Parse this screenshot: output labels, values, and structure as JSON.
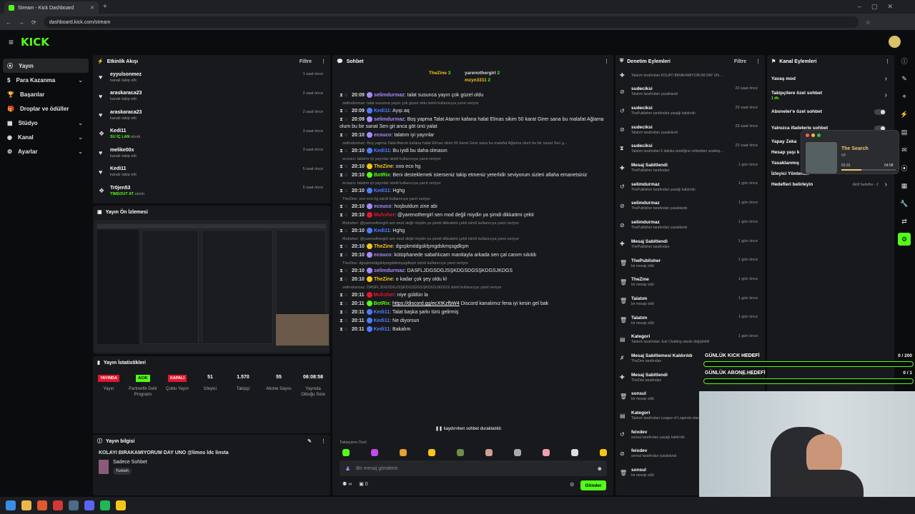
{
  "browser": {
    "tab_title": "Stream - Kick Dashboard",
    "url": "dashboard.kick.com/stream"
  },
  "brand": {
    "logo": "KICK",
    "accent": "#53fc18"
  },
  "sidebar": {
    "items": [
      {
        "label": "Yayın",
        "icon": "broadcast-icon",
        "active": true
      },
      {
        "label": "Para Kazanma",
        "icon": "money-icon",
        "chevron": true
      },
      {
        "label": "Başarılar",
        "icon": "trophy-icon"
      },
      {
        "label": "Droplar ve ödüller",
        "icon": "gift-icon"
      },
      {
        "label": "Stüdyo",
        "icon": "studio-icon",
        "chevron": true
      },
      {
        "label": "Kanal",
        "icon": "channel-icon",
        "chevron": true
      },
      {
        "label": "Ayarlar",
        "icon": "gear-icon",
        "chevron": true
      }
    ]
  },
  "activity": {
    "title": "Etkinlik Akışı",
    "filter": "Filtre",
    "events": [
      {
        "user": "eyyulsonmez",
        "action": "kanalı takip etti",
        "time": "1 saat önce",
        "icon": "heart-icon"
      },
      {
        "user": "araskaraca23",
        "action": "kanalı takip etti",
        "time": "2 saat önce",
        "icon": "heart-icon"
      },
      {
        "user": "araskaraca23",
        "action": "kanalı takip etti",
        "time": "2 saat önce",
        "icon": "heart-icon"
      },
      {
        "user": "Kedi11",
        "action": "SU İÇ LAN",
        "action2": "alındı",
        "time": "3 saat önce",
        "icon": "reward-icon"
      },
      {
        "user": "melike00x",
        "action": "kanalı takip etti",
        "time": "3 saat önce",
        "icon": "heart-icon"
      },
      {
        "user": "Kedi11",
        "action": "kanalı takip etti",
        "time": "5 saat önce",
        "icon": "heart-icon"
      },
      {
        "user": "Tr0jen53",
        "action": "TIMEOUT AT",
        "action2": "alındı",
        "time": "5 saat önce",
        "icon": "reward-icon"
      }
    ]
  },
  "preview": {
    "title": "Yayın Ön İzlemesi"
  },
  "stats": {
    "title": "Yayın İstatistikleri",
    "items": [
      {
        "tag": "YAYINDA",
        "label": "Yayın"
      },
      {
        "tag": "ACIK",
        "label": "Partnerlik Gelir Programı"
      },
      {
        "tag": "KAPALI",
        "label": "Çoklu Yayın"
      },
      {
        "value": "51",
        "label": "İzleyici"
      },
      {
        "value": "1.570",
        "label": "Takipçi"
      },
      {
        "value": "55",
        "label": "Abone Sayısı"
      },
      {
        "value": "06:08:58",
        "label": "Yayında Olduğu Süre"
      }
    ]
  },
  "info": {
    "title": "Yayın bilgisi",
    "stream_title": "KOLAYI BIRAKAMIYORUM DAY UNO @limos ldc linsta",
    "category": "Sadece Sohbet",
    "language": "Turkish"
  },
  "chat": {
    "title": "Sohbet",
    "pinned": [
      {
        "user": "TheZine",
        "value": "3"
      },
      {
        "user": "yarenothergirl",
        "value": "2"
      },
      {
        "user": "mzyn3311",
        "value": "2"
      }
    ],
    "messages": [
      {
        "time": "20:09",
        "user": "selimdurmaz",
        "color": "#a78bfa",
        "text": "talat susunca yayın çok güzel oldu"
      },
      {
        "reply": "selimdurmaz: talat susunca yayın çok güzel oldu isimli kullanıcıya yanıt veriyor"
      },
      {
        "time": "20:09",
        "user": "Kedi11",
        "color": "#4d7cff",
        "text": "Ayıp aq"
      },
      {
        "time": "20:09",
        "user": "selimdurmaz",
        "color": "#a78bfa",
        "text": "Boş yapma Talat Atarım kafana halat Elmas sikim 50 karat Girer sana bu malafat Ağlama olum bu bir sanat Sen git anca göt ünü yalat"
      },
      {
        "time": "20:10",
        "user": "ecouco",
        "color": "#a78bfa",
        "text": "talatım iyi yayınlar"
      },
      {
        "reply": "selimdurmaz: Boş yapma Talat Atarım kafana halat Elmas sikim 50 karat Girer sana bu malafat Ağlama olum bu bir sanat Sen g..."
      },
      {
        "time": "20:10",
        "user": "Kedi11",
        "color": "#4d7cff",
        "text": "Bu iyidi bu daha olmasın"
      },
      {
        "reply": "ecouco: talatım iyi yayınlar isimli kullanıcıya yanıt veriyor"
      },
      {
        "time": "20:10",
        "user": "TheZine",
        "color": "#f5c518",
        "text": "ooo eco hg"
      },
      {
        "time": "20:10",
        "user": "BotRix",
        "color": "#53fc18",
        "text": "Beni desteklemek isterseniz takip etmeniz yeterlidir seviyorum sizleri allaha emanetsiniz"
      },
      {
        "reply": "ecouco: talatım iyi yayınlar isimli kullanıcıya yanıt veriyor"
      },
      {
        "time": "20:10",
        "user": "Kedi11",
        "color": "#4d7cff",
        "text": "Hghg"
      },
      {
        "reply": "TheZine: ooo eco hg isimli kullanıcıya yanıt veriyor"
      },
      {
        "time": "20:10",
        "user": "ecouco",
        "color": "#a78bfa",
        "text": "hoşbuldum zine abi"
      },
      {
        "time": "20:10",
        "user": "Muhsher",
        "color": "#e0182d",
        "text": "@yarenothergirl sen mod değil miydin ya şimdi dikkatimi çekti"
      },
      {
        "reply": "Muhsher: @yarenothergirl sen mod değil miydin ya şimdi dikkatimi çekti isimli kullanıcıya yanıt veriyor"
      },
      {
        "time": "20:10",
        "user": "Kedi11",
        "color": "#4d7cff",
        "text": "Hghg"
      },
      {
        "reply": "Muhsher: @yarenothergirl sen mod değil miydin ya şimdi dikkatimi çekti isimli kullanıcıya yanıt veriyor"
      },
      {
        "time": "20:10",
        "user": "TheZine",
        "color": "#f5c518",
        "text": "dgsşkmödgsklşmgdskmşsgdkşm"
      },
      {
        "time": "20:10",
        "user": "ecouco",
        "color": "#a78bfa",
        "text": "kütüphanede sabahlıcam manitayla arkada sen çal canım sıkıldı"
      },
      {
        "reply": "TheZine: dgsşkmödgsklşmgdskmşsgdkşm isimli kullanıcıya yanıt veriyor"
      },
      {
        "time": "20:10",
        "user": "selimdurmaz",
        "color": "#a78bfa",
        "text": "DASFLJDGSDGJSŞKDGSDGSŞKDGSJKDGS"
      },
      {
        "time": "20:10",
        "user": "TheZine",
        "color": "#f5c518",
        "text": "o kadar çok şey oldu kl"
      },
      {
        "reply": "selimdurmaz: DASFLJDGSDGJSŞKDGSDGSŞKDGSJKDGS isimli kullanıcıya yanıt veriyor"
      },
      {
        "time": "20:11",
        "user": "Muhsher",
        "color": "#e0182d",
        "text": "niye güldün la"
      },
      {
        "time": "20:11",
        "user": "BotRix",
        "color": "#53fc18",
        "link": "https://discord.gg/ecXtKzfbW4",
        "text": "Discord kanalımız fena iyi kesin gel bak"
      },
      {
        "time": "20:11",
        "user": "Kedi11",
        "color": "#4d7cff",
        "text": "Talat başka şarkı türü gelirmiş"
      },
      {
        "time": "20:11",
        "user": "Kedi11",
        "color": "#4d7cff",
        "text": "Ne diyorsun"
      },
      {
        "time": "20:11",
        "user": "Kedi11",
        "color": "#4d7cff",
        "text": "Bakalım"
      }
    ],
    "paused": "kaydırırken sohbet duraklatıldı",
    "emote_label": "Takipçiere Özel",
    "input_placeholder": "Bir mesaj gönderin",
    "send": "Gönder",
    "count_users": "∞",
    "count_points": "0"
  },
  "mod": {
    "title": "Denetim Eylemleri",
    "filter": "Filtre",
    "entries": [
      {
        "user": "",
        "detail": "Talatım tarafından KOLAYI BIRAKAMIYORUM DAY UNO ldc linsta olarak değiştirildi",
        "time": "",
        "icon": "pin-icon"
      },
      {
        "user": "sudeciksi",
        "detail": "Talatım tarafından yasaklandı",
        "time": "23 saat önce",
        "icon": "ban-icon"
      },
      {
        "user": "sudeciksi",
        "detail": "ThePublisher tarafından yasağı kaldırıldı",
        "time": "23 saat önce",
        "icon": "unban-icon"
      },
      {
        "user": "sudeciksi",
        "detail": "Talatım tarafından yasaklandı",
        "time": "23 saat önce",
        "icon": "ban-icon"
      },
      {
        "user": "sudeciksi",
        "detail": "Talatım tarafından 5 dakika süreliğine sohbetten uzaklaştırıldı",
        "time": "23 saat önce",
        "icon": "timeout-icon"
      },
      {
        "user": "Mesaj Sabitlendi",
        "detail": "ThePublisher tarafından",
        "time": "1 gün önce",
        "icon": "pin-icon"
      },
      {
        "user": "selimdurmaz",
        "detail": "ThePublisher tarafından yasağı kaldırıldı",
        "time": "1 gün önce",
        "icon": "unban-icon"
      },
      {
        "user": "selimdurmaz",
        "detail": "ThePublisher tarafından yasaklandı",
        "time": "1 gün önce",
        "icon": "ban-icon"
      },
      {
        "user": "selimdurmaz",
        "detail": "ThePublisher tarafından yasaklandı",
        "time": "1 gün önce",
        "icon": "ban-icon"
      },
      {
        "user": "Mesaj Sabitlendi",
        "detail": "ThePublisher tarafından",
        "time": "1 gün önce",
        "icon": "pin-icon"
      },
      {
        "user": "ThePublisher",
        "detail": "bir mesajı sildi",
        "time": "1 gün önce",
        "icon": "trash-icon"
      },
      {
        "user": "TheZine",
        "detail": "bir mesajı sildi",
        "time": "1 gün önce",
        "icon": "trash-icon"
      },
      {
        "user": "Talatım",
        "detail": "bir mesajı sildi",
        "time": "1 gün önce",
        "icon": "trash-icon"
      },
      {
        "user": "Talatım",
        "detail": "bir mesajı sildi",
        "time": "1 gün önce",
        "icon": "trash-icon"
      },
      {
        "user": "Kategori",
        "detail": "Talatım tarafından Just Chatting olarak değiştirildi",
        "time": "1 gün önce",
        "icon": "category-icon"
      },
      {
        "user": "Mesaj Sabitlemesi Kaldırıldı",
        "detail": "TheZine tarafından",
        "time": "1 gün önce",
        "icon": "unpin-icon"
      },
      {
        "user": "Mesaj Sabitlendi",
        "detail": "TheZine tarafından",
        "time": "1 gün önce",
        "icon": "pin-icon"
      },
      {
        "user": "sonsul",
        "detail": "bir mesajı sildi",
        "time": "1 gün önce",
        "icon": "trash-icon"
      },
      {
        "user": "Kategori",
        "detail": "Talatım tarafından League of Legends olarak değiştirildi",
        "time": "1 gün önce",
        "icon": "category-icon"
      },
      {
        "user": "feixdev",
        "detail": "sonsul tarafından yasağı kaldırıldı",
        "time": "1 gün önce",
        "icon": "unban-icon"
      },
      {
        "user": "feixdev",
        "detail": "sonsul tarafından yasaklandı",
        "time": "1 gün önce",
        "icon": "ban-icon"
      },
      {
        "user": "sonsul",
        "detail": "bir mesajı sildi",
        "time": "1 gün önce",
        "icon": "trash-icon"
      }
    ]
  },
  "channel": {
    "title": "Kanal Eylemleri",
    "items": [
      {
        "label": "Yavaş mod",
        "type": "chevron"
      },
      {
        "label": "Takipçilere özel sohbet",
        "sub": "1 dk.",
        "type": "chevron"
      },
      {
        "label": "Aboneler'e özel sohbet",
        "type": "toggle"
      },
      {
        "label": "Yalnızca ifadelerle sohbet",
        "type": "toggle"
      },
      {
        "label": "Yapay Zeka",
        "type": "none"
      },
      {
        "label": "Hesap yaşı k",
        "type": "none"
      },
      {
        "label": "Yasaklanmış",
        "type": "none"
      },
      {
        "label": "İzleyici Yönlendir",
        "type": "none"
      },
      {
        "label": "Hedefleri belirleyin",
        "extra": "Aktif hedefler - 2",
        "type": "chevron"
      }
    ]
  },
  "music": {
    "title": "The Search",
    "artist": "NF",
    "elapsed": "01:31",
    "total": "04:08",
    "progress": 0.37
  },
  "goals": [
    {
      "label": "GÜNLÜK KICK HEDEFİ",
      "value": "0 / 200"
    },
    {
      "label": "GÜNLÜK ABONE HEDEFİ",
      "value": "0 / 1"
    }
  ]
}
